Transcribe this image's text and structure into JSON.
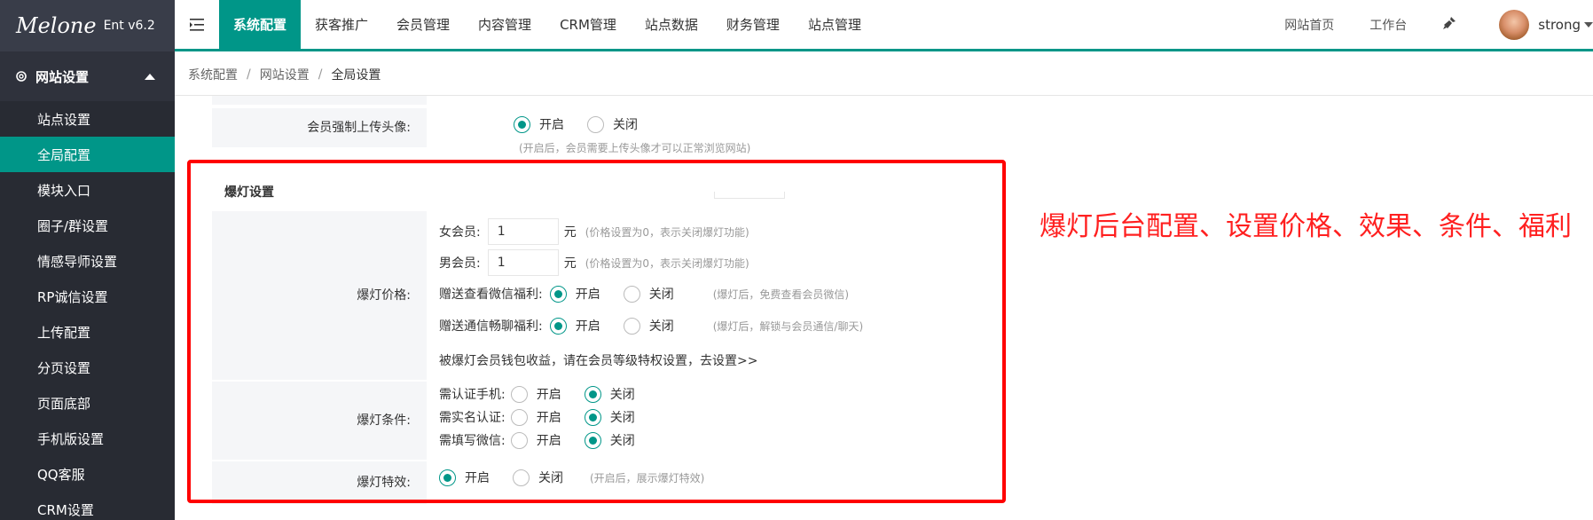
{
  "brand": {
    "logo_text": "Melone",
    "version": "Ent v6.2"
  },
  "sidebar": {
    "group_label": "网站设置",
    "items": [
      {
        "label": "站点设置",
        "active": false
      },
      {
        "label": "全局配置",
        "active": true
      },
      {
        "label": "模块入口",
        "active": false
      },
      {
        "label": "圈子/群设置",
        "active": false
      },
      {
        "label": "情感导师设置",
        "active": false
      },
      {
        "label": "RP诚信设置",
        "active": false
      },
      {
        "label": "上传配置",
        "active": false
      },
      {
        "label": "分页设置",
        "active": false
      },
      {
        "label": "页面底部",
        "active": false
      },
      {
        "label": "手机版设置",
        "active": false
      },
      {
        "label": "QQ客服",
        "active": false
      },
      {
        "label": "CRM设置",
        "active": false
      }
    ]
  },
  "topnav": {
    "items": [
      "系统配置",
      "获客推广",
      "会员管理",
      "内容管理",
      "CRM管理",
      "站点数据",
      "财务管理",
      "站点管理"
    ],
    "right": {
      "home": "网站首页",
      "workbench": "工作台",
      "username": "strong"
    }
  },
  "breadcrumb": [
    "系统配置",
    "网站设置",
    "全局设置"
  ],
  "form": {
    "avatar_required": {
      "label": "会员强制上传头像:",
      "on": "开启",
      "off": "关闭",
      "value": "on",
      "hint": "(开启后，会员需要上传头像才可以正常浏览网站)"
    },
    "section_title": "爆灯设置",
    "price": {
      "label": "爆灯价格:",
      "female": {
        "label": "女会员:",
        "value": "1",
        "unit": "元",
        "hint": "(价格设置为0，表示关闭爆灯功能)"
      },
      "male": {
        "label": "男会员:",
        "value": "1",
        "unit": "元",
        "hint": "(价格设置为0，表示关闭爆灯功能)"
      },
      "wechat_gift": {
        "label": "赠送查看微信福利:",
        "on": "开启",
        "off": "关闭",
        "value": "on",
        "hint": "(爆灯后，免费查看会员微信)"
      },
      "chat_gift": {
        "label": "赠送通信畅聊福利:",
        "on": "开启",
        "off": "关闭",
        "value": "on",
        "hint": "(爆灯后，解锁与会员通信/聊天)"
      },
      "wallet_note": "被爆灯会员钱包收益，请在会员等级特权设置，去设置>>"
    },
    "conditions": {
      "label": "爆灯条件:",
      "items": [
        {
          "label": "需认证手机:",
          "on": "开启",
          "off": "关闭",
          "value": "off"
        },
        {
          "label": "需实名认证:",
          "on": "开启",
          "off": "关闭",
          "value": "off"
        },
        {
          "label": "需填写微信:",
          "on": "开启",
          "off": "关闭",
          "value": "off"
        }
      ]
    },
    "effect": {
      "label": "爆灯特效:",
      "on": "开启",
      "off": "关闭",
      "value": "on",
      "hint": "(开启后，展示爆灯特效)"
    }
  },
  "annotation": "爆灯后台配置、设置价格、效果、条件、福利",
  "colors": {
    "accent": "#009688",
    "sidebar": "#393d49",
    "annotation": "#ff0000"
  }
}
